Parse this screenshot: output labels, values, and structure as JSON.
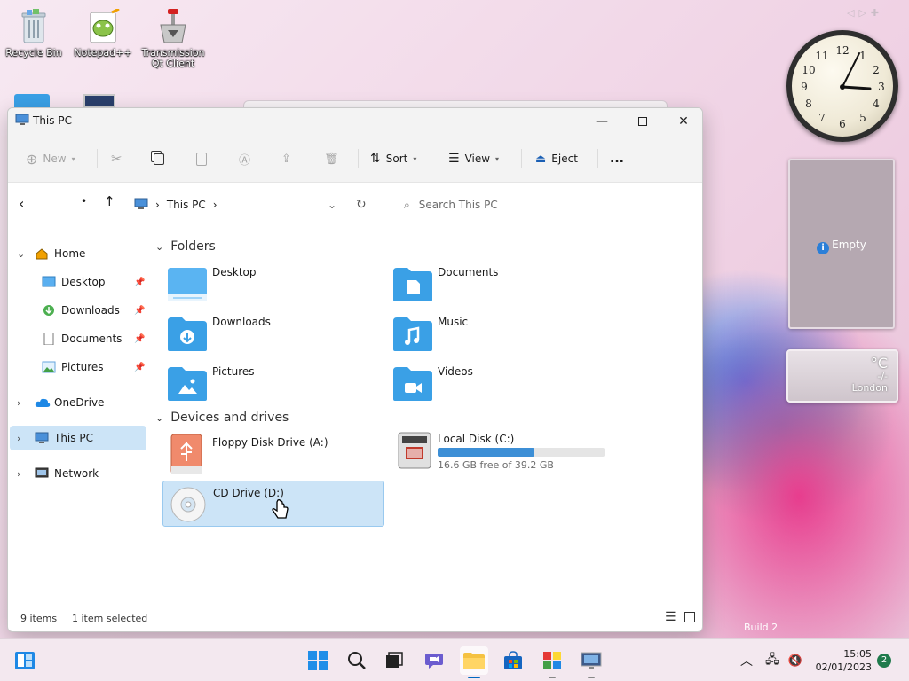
{
  "desktop": {
    "icons": [
      {
        "label": "Recycle Bin"
      },
      {
        "label": "Notepad++"
      },
      {
        "label": "Transmission Qt Client"
      }
    ],
    "watermark": "Build 2"
  },
  "gadgets": {
    "empty_label": "Empty",
    "weather": {
      "unit": "°C",
      "temp": "-/-",
      "city": "London"
    }
  },
  "window": {
    "title": "This PC",
    "commands": {
      "new": "New",
      "sort": "Sort",
      "view": "View",
      "eject": "Eject",
      "more": "..."
    },
    "address": {
      "location": "This PC"
    },
    "search": {
      "placeholder": "Search This PC"
    },
    "nav": {
      "items": [
        {
          "label": "Home"
        },
        {
          "label": "Desktop"
        },
        {
          "label": "Downloads"
        },
        {
          "label": "Documents"
        },
        {
          "label": "Pictures"
        },
        {
          "label": "OneDrive"
        },
        {
          "label": "This PC"
        },
        {
          "label": "Network"
        }
      ]
    },
    "content": {
      "folders_header": "Folders",
      "folders": [
        {
          "name": "Desktop"
        },
        {
          "name": "Documents"
        },
        {
          "name": "Downloads"
        },
        {
          "name": "Music"
        },
        {
          "name": "Pictures"
        },
        {
          "name": "Videos"
        }
      ],
      "drives_header": "Devices and drives",
      "drives": [
        {
          "name": "Floppy Disk Drive (A:)"
        },
        {
          "name": "Local Disk (C:)",
          "free": "16.6 GB free of 39.2 GB",
          "used_fraction": 0.58
        },
        {
          "name": "CD Drive (D:)"
        }
      ]
    },
    "status": {
      "count": "9 items",
      "selection": "1 item selected"
    }
  },
  "taskbar": {
    "time": "15:05",
    "date": "02/01/2023",
    "notifications": "2"
  },
  "colors": {
    "accent": "#0067c0",
    "selection": "#cce4f7",
    "folder": "#3aa0e6"
  }
}
